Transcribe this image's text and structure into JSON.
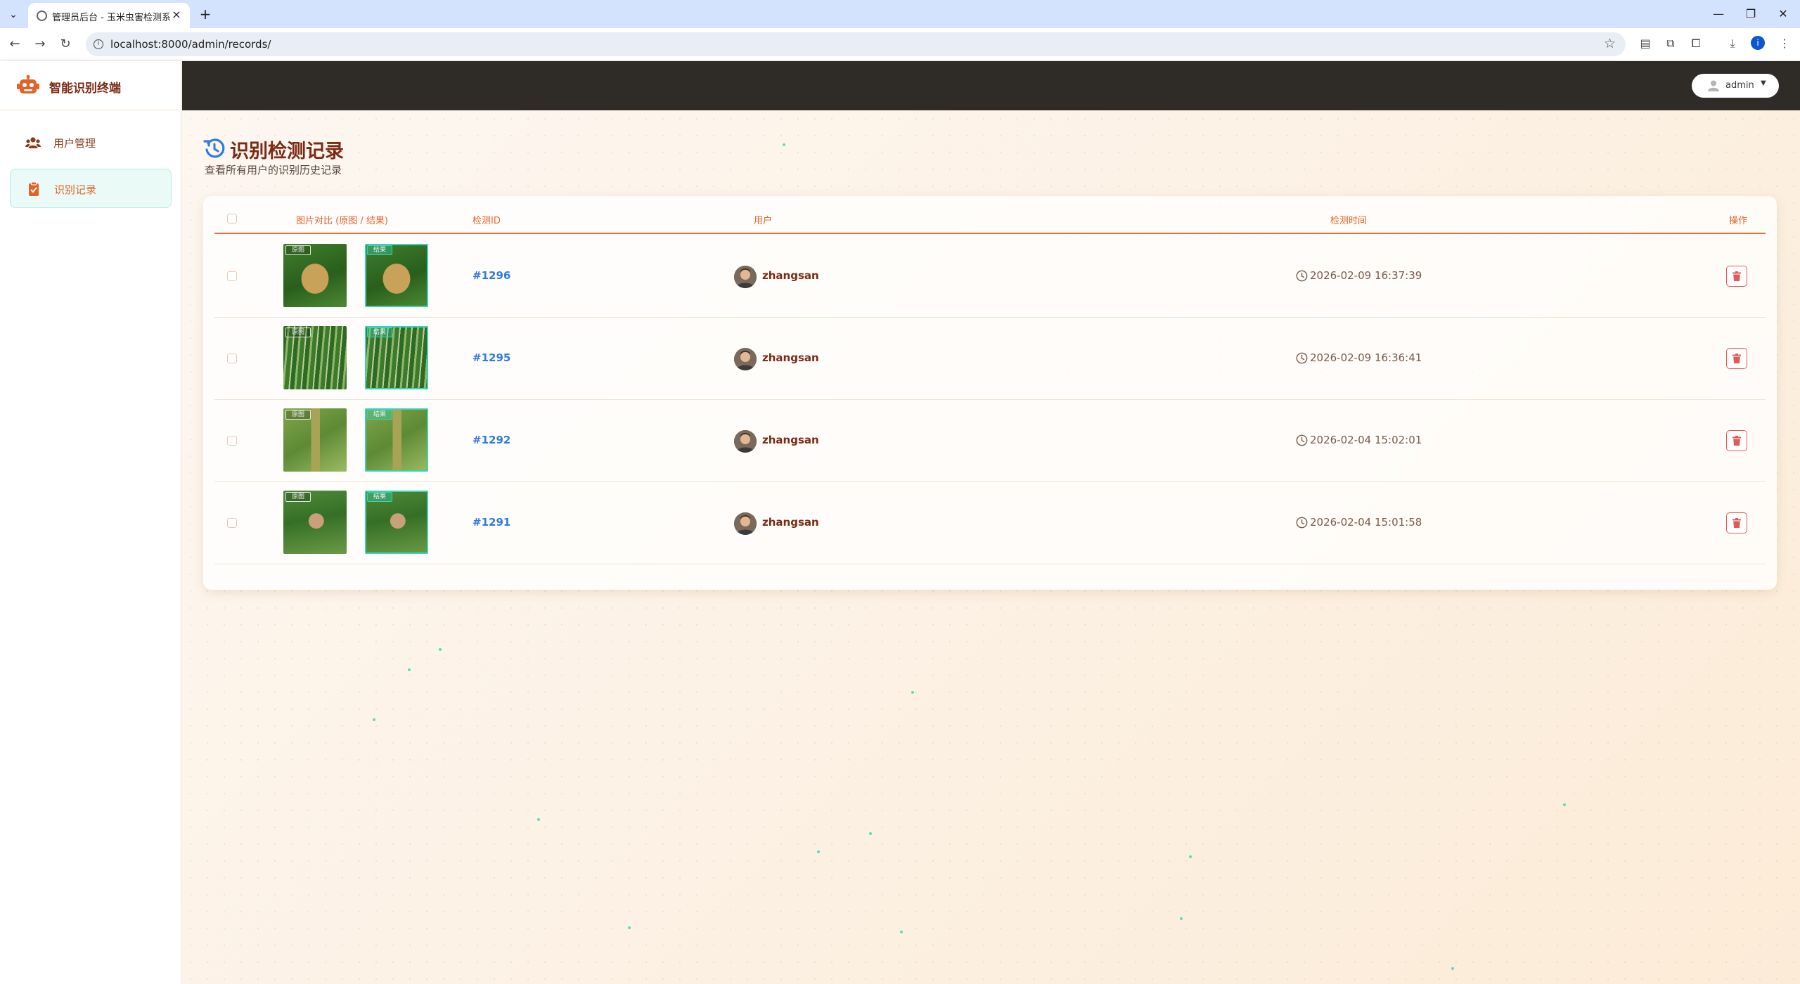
{
  "browser": {
    "tab_title": "管理员后台 - 玉米虫害检测系统",
    "url": "localhost:8000/admin/records/",
    "profile_initial": "i"
  },
  "sidebar": {
    "brand": "智能识别终端",
    "items": [
      {
        "label": "用户管理",
        "icon": "users-icon",
        "active": false
      },
      {
        "label": "识别记录",
        "icon": "clipboard-check-icon",
        "active": true
      }
    ]
  },
  "topbar": {
    "user": "admin"
  },
  "page": {
    "title": "识别检测记录",
    "subtitle": "查看所有用户的识别历史记录"
  },
  "table": {
    "headers": {
      "images": "图片对比 (原图 / 结果)",
      "id": "检测ID",
      "user": "用户",
      "time": "检测时间",
      "action": "操作"
    },
    "thumb_tags": {
      "original": "原图",
      "result": "结果"
    },
    "rows": [
      {
        "id": "#1296",
        "user": "zhangsan",
        "time": "2026-02-09 16:37:39",
        "scene": "moth-leaf"
      },
      {
        "id": "#1295",
        "user": "zhangsan",
        "time": "2026-02-09 16:36:41",
        "scene": "corn-tassel"
      },
      {
        "id": "#1292",
        "user": "zhangsan",
        "time": "2026-02-04 15:02:01",
        "scene": "corn-stalk"
      },
      {
        "id": "#1291",
        "user": "zhangsan",
        "time": "2026-02-04 15:01:58",
        "scene": "moth-grass"
      }
    ]
  },
  "colors": {
    "accent": "#e0642a",
    "brand_text": "#7a2a14",
    "link": "#2f7ae5",
    "topbar": "#2f2c28",
    "danger": "#e05a5a",
    "active_bg": "#eafaf6"
  }
}
